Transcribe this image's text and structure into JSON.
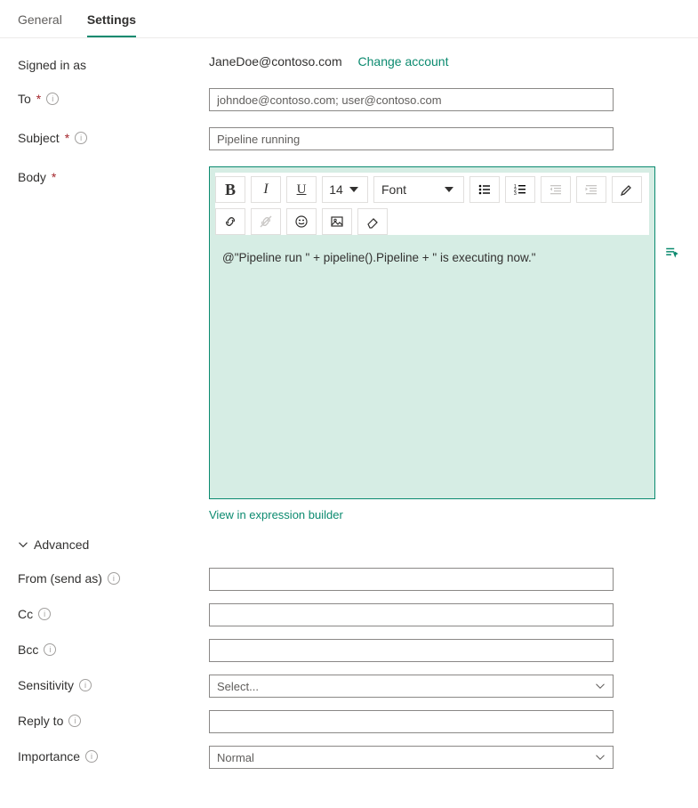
{
  "tabs": {
    "general": "General",
    "settings": "Settings"
  },
  "signed_in": {
    "label": "Signed in as",
    "email": "JaneDoe@contoso.com",
    "change": "Change account"
  },
  "to": {
    "label": "To",
    "value": "johndoe@contoso.com; user@contoso.com"
  },
  "subject": {
    "label": "Subject",
    "value": "Pipeline running"
  },
  "body": {
    "label": "Body",
    "content": "@\"Pipeline run \" + pipeline().Pipeline + \" is executing now.\"",
    "view_link": "View in expression builder",
    "toolbar": {
      "font_size": "14",
      "font_label": "Font"
    }
  },
  "advanced": {
    "header": "Advanced",
    "from": {
      "label": "From (send as)",
      "value": ""
    },
    "cc": {
      "label": "Cc",
      "value": ""
    },
    "bcc": {
      "label": "Bcc",
      "value": ""
    },
    "sensitivity": {
      "label": "Sensitivity",
      "value": "Select..."
    },
    "reply_to": {
      "label": "Reply to",
      "value": ""
    },
    "importance": {
      "label": "Importance",
      "value": "Normal"
    }
  }
}
